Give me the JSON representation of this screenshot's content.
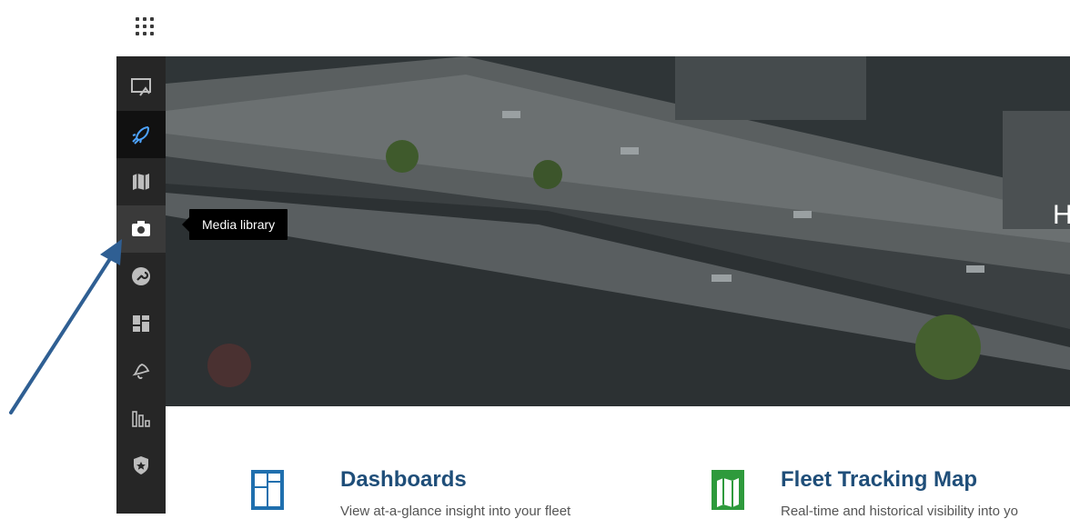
{
  "top_bar": {
    "app_launcher_icon": "app-grid-icon"
  },
  "sidebar": {
    "items": [
      {
        "name": "sidebar-item-presentation",
        "icon": "presentation-screen-icon",
        "state": "normal"
      },
      {
        "name": "sidebar-item-getting-started",
        "icon": "rocket-icon",
        "state": "active"
      },
      {
        "name": "sidebar-item-map",
        "icon": "map-icon",
        "state": "normal"
      },
      {
        "name": "sidebar-item-media-library",
        "icon": "camera-icon",
        "state": "hover"
      },
      {
        "name": "sidebar-item-tools",
        "icon": "wrench-icon",
        "state": "normal"
      },
      {
        "name": "sidebar-item-dashboards",
        "icon": "dashboard-icon",
        "state": "normal"
      },
      {
        "name": "sidebar-item-alerts",
        "icon": "bell-icon",
        "state": "normal"
      },
      {
        "name": "sidebar-item-reports",
        "icon": "bar-chart-icon",
        "state": "normal"
      },
      {
        "name": "sidebar-item-security",
        "icon": "shield-icon",
        "state": "normal"
      }
    ]
  },
  "tooltip": {
    "text": "Media library"
  },
  "hero": {
    "title_partial": "H"
  },
  "cards": [
    {
      "title": "Dashboards",
      "description": "View at-a-glance insight into your fleet",
      "icon": "dashboard-icon",
      "color": "#1f6fae"
    },
    {
      "title": "Fleet Tracking Map",
      "description": "Real-time and historical visibility into yo",
      "icon": "map-icon",
      "color": "#2e9a3c"
    }
  ],
  "colors": {
    "sidebar": "#262626",
    "active_icon": "#4da3ff",
    "arrow": "#2f5f93",
    "card_title": "#1f4e79"
  }
}
